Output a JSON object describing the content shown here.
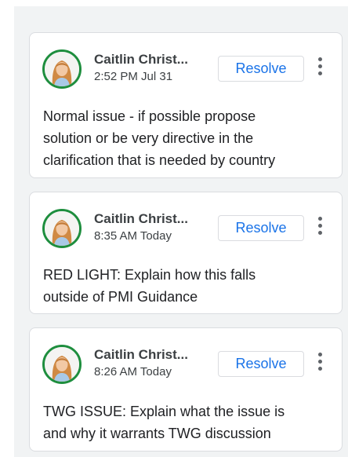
{
  "comments": [
    {
      "author": "Caitlin Christ...",
      "time": "2:52 PM Jul 31",
      "resolve_label": "Resolve",
      "avatar_icon": "user-avatar-photo",
      "more_icon": "more-vert-icon",
      "text_lines": [
        "Normal issue - if possible propose",
        "solution or be very directive in the",
        "clarification that is needed by country"
      ]
    },
    {
      "author": "Caitlin Christ...",
      "time": "8:35 AM Today",
      "resolve_label": "Resolve",
      "avatar_icon": "user-avatar-photo",
      "more_icon": "more-vert-icon",
      "text_lines": [
        "RED LIGHT: Explain how this falls",
        "outside of PMI Guidance"
      ]
    },
    {
      "author": "Caitlin Christ...",
      "time": "8:26 AM Today",
      "resolve_label": "Resolve",
      "avatar_icon": "user-avatar-photo",
      "more_icon": "more-vert-icon",
      "text_lines": [
        "TWG ISSUE: Explain what the issue is",
        "and why it warrants TWG discussion"
      ]
    }
  ],
  "colors": {
    "panel_bg": "#f1f3f4",
    "card_border": "#dadce0",
    "resolve_text": "#1a73e8",
    "avatar_ring": "#1e8e3e"
  }
}
